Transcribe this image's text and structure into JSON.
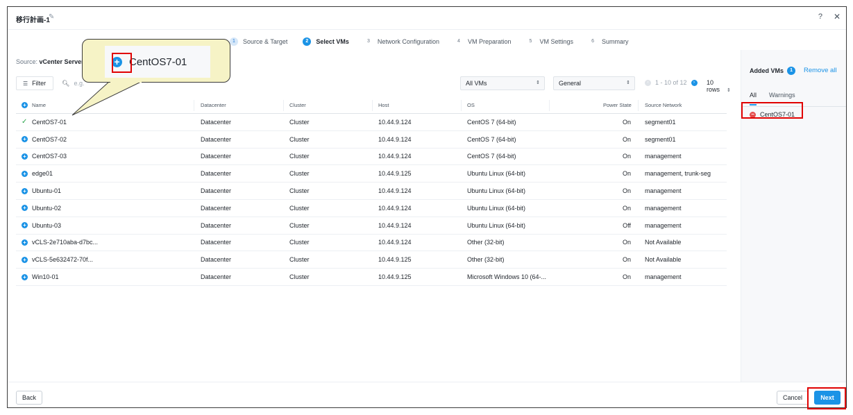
{
  "header": {
    "title": "移行計画-1",
    "help": "?",
    "close": "✕"
  },
  "stepper": [
    {
      "num": "1",
      "label": "Source & Target",
      "state": "done"
    },
    {
      "num": "2",
      "label": "Select VMs",
      "state": "active"
    },
    {
      "num": "3",
      "label": "Network Configuration",
      "state": "todo"
    },
    {
      "num": "4",
      "label": "VM Preparation",
      "state": "todo"
    },
    {
      "num": "5",
      "label": "VM Settings",
      "state": "todo"
    },
    {
      "num": "6",
      "label": "Summary",
      "state": "todo"
    }
  ],
  "source": {
    "label": "Source:",
    "value": "vCenter Server"
  },
  "toolbar": {
    "filter_label": "Filter",
    "search_placeholder": "e.g.",
    "vm_scope": "All VMs",
    "view": "General",
    "pager_text": "1 - 10 of 12",
    "rows_label": "10 rows"
  },
  "table": {
    "headers": [
      "Name",
      "Datacenter",
      "Cluster",
      "Host",
      "OS",
      "Power State",
      "Source Network"
    ],
    "rows": [
      {
        "name": "CentOS7-01",
        "datacenter": "Datacenter",
        "cluster": "Cluster",
        "host": "10.44.9.124",
        "os": "CentOS 7 (64-bit)",
        "power": "On",
        "network": "segment01",
        "added": true
      },
      {
        "name": "CentOS7-02",
        "datacenter": "Datacenter",
        "cluster": "Cluster",
        "host": "10.44.9.124",
        "os": "CentOS 7 (64-bit)",
        "power": "On",
        "network": "segment01",
        "added": false
      },
      {
        "name": "CentOS7-03",
        "datacenter": "Datacenter",
        "cluster": "Cluster",
        "host": "10.44.9.124",
        "os": "CentOS 7 (64-bit)",
        "power": "On",
        "network": "management",
        "added": false
      },
      {
        "name": "edge01",
        "datacenter": "Datacenter",
        "cluster": "Cluster",
        "host": "10.44.9.125",
        "os": "Ubuntu Linux (64-bit)",
        "power": "On",
        "network": "management, trunk-seg",
        "added": false
      },
      {
        "name": "Ubuntu-01",
        "datacenter": "Datacenter",
        "cluster": "Cluster",
        "host": "10.44.9.124",
        "os": "Ubuntu Linux (64-bit)",
        "power": "On",
        "network": "management",
        "added": false
      },
      {
        "name": "Ubuntu-02",
        "datacenter": "Datacenter",
        "cluster": "Cluster",
        "host": "10.44.9.124",
        "os": "Ubuntu Linux (64-bit)",
        "power": "On",
        "network": "management",
        "added": false
      },
      {
        "name": "Ubuntu-03",
        "datacenter": "Datacenter",
        "cluster": "Cluster",
        "host": "10.44.9.124",
        "os": "Ubuntu Linux (64-bit)",
        "power": "Off",
        "network": "management",
        "added": false
      },
      {
        "name": "vCLS-2e710aba-d7bc...",
        "datacenter": "Datacenter",
        "cluster": "Cluster",
        "host": "10.44.9.124",
        "os": "Other (32-bit)",
        "power": "On",
        "network": "Not Available",
        "added": false
      },
      {
        "name": "vCLS-5e632472-70f...",
        "datacenter": "Datacenter",
        "cluster": "Cluster",
        "host": "10.44.9.125",
        "os": "Other (32-bit)",
        "power": "On",
        "network": "Not Available",
        "added": false
      },
      {
        "name": "Win10-01",
        "datacenter": "Datacenter",
        "cluster": "Cluster",
        "host": "10.44.9.125",
        "os": "Microsoft Windows 10 (64-...",
        "power": "On",
        "network": "management",
        "added": false
      }
    ]
  },
  "right_panel": {
    "title": "Added VMs",
    "count": "1",
    "remove_all": "Remove all",
    "tabs": [
      "All",
      "Warnings"
    ],
    "items": [
      "CentOS7-01"
    ]
  },
  "footer": {
    "back": "Back",
    "cancel": "Cancel",
    "next": "Next"
  },
  "callout": {
    "text": "CentOS7-01"
  },
  "colors": {
    "accent": "#1b93e6",
    "annotation": "#e00000",
    "callout_bg": "#f6f3c6",
    "remove": "#e44d4d",
    "check": "#2aa54a"
  }
}
